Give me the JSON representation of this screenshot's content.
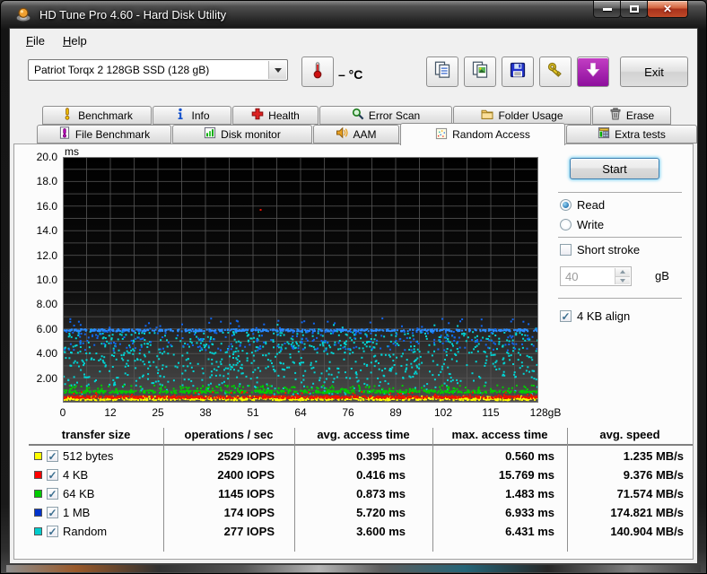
{
  "window": {
    "title": "HD Tune Pro 4.60 - Hard Disk Utility"
  },
  "menu": {
    "file": "File",
    "help": "Help"
  },
  "toolbar": {
    "drive": "Patriot Torqx 2 128GB SSD (128 gB)",
    "temperature": "– °C",
    "buttons": [
      {
        "name": "copy-text-button",
        "icon": "copy-text-icon"
      },
      {
        "name": "copy-image-button",
        "icon": "copy-image-icon"
      },
      {
        "name": "save-button",
        "icon": "save-icon"
      },
      {
        "name": "keys-button",
        "icon": "keys-icon"
      },
      {
        "name": "capture-button",
        "icon": "capture-icon"
      }
    ],
    "exit": "Exit"
  },
  "tabs": {
    "row1": [
      {
        "label": "Benchmark",
        "icon": "benchmark-icon"
      },
      {
        "label": "Info",
        "icon": "info-icon"
      },
      {
        "label": "Health",
        "icon": "health-icon"
      },
      {
        "label": "Error Scan",
        "icon": "error-scan-icon"
      },
      {
        "label": "Folder Usage",
        "icon": "folder-usage-icon"
      },
      {
        "label": "Erase",
        "icon": "erase-icon"
      }
    ],
    "row2": [
      {
        "label": "File Benchmark",
        "icon": "file-benchmark-icon"
      },
      {
        "label": "Disk monitor",
        "icon": "disk-monitor-icon"
      },
      {
        "label": "AAM",
        "icon": "aam-icon"
      },
      {
        "label": "Random Access",
        "icon": "random-access-icon",
        "active": true
      },
      {
        "label": "Extra tests",
        "icon": "extra-tests-icon"
      }
    ]
  },
  "panel": {
    "start": "Start",
    "read": {
      "label": "Read",
      "selected": true
    },
    "write": {
      "label": "Write",
      "selected": false
    },
    "short_stroke": {
      "label": "Short stroke",
      "checked": false,
      "value": "40",
      "unit": "gB"
    },
    "align": {
      "label": "4 KB align",
      "checked": true
    }
  },
  "chart_data": {
    "type": "scatter",
    "title": "Random Access benchmark (access time vs disk position)",
    "x_axis": {
      "unit": "gB",
      "min": 0,
      "max": 128,
      "tick_labels": [
        "0",
        "12",
        "25",
        "38",
        "51",
        "64",
        "76",
        "89",
        "102",
        "115",
        "128gB"
      ]
    },
    "y_axis": {
      "unit": "ms",
      "min": 0,
      "max": 20,
      "tick_labels": [
        "20.0",
        "18.0",
        "16.0",
        "14.0",
        "12.0",
        "10.0",
        "8.00",
        "6.00",
        "4.00",
        "2.00"
      ]
    },
    "plot_bg_top": "#000000",
    "plot_bg_bottom": "#4e4e4e",
    "grid_color": "#565656",
    "grid": true,
    "series": [
      {
        "name": "Random",
        "color": "#00d4d4",
        "bands": [
          {
            "count": 340,
            "y_min": 4.25,
            "y_max": 5.85
          },
          {
            "count": 430,
            "y_min": 1.9,
            "y_max": 4.25
          },
          {
            "count": 120,
            "y_min": 0.75,
            "y_max": 1.9,
            "x_bias": 1.5
          },
          {
            "count": 14,
            "y_min": 5.85,
            "y_max": 6.43
          }
        ]
      },
      {
        "name": "512 bytes",
        "color": "#ffff00",
        "bands": [
          {
            "count": 620,
            "y_min": 0.27,
            "y_max": 0.5
          },
          {
            "count": 50,
            "y_min": 0.5,
            "y_max": 0.6
          }
        ]
      },
      {
        "name": "64 KB",
        "color": "#00cc00",
        "bands": [
          {
            "count": 480,
            "y_min": 0.86,
            "y_max": 1.06
          },
          {
            "count": 150,
            "y_min": 1.06,
            "y_max": 1.48
          }
        ]
      },
      {
        "name": "4 KB",
        "color": "#ee1100",
        "bands": [
          {
            "count": 620,
            "y_min": 0.43,
            "y_max": 0.62
          },
          {
            "count": 40,
            "y_min": 0.62,
            "y_max": 0.95
          }
        ],
        "outliers": [
          {
            "x": 53,
            "y": 15.769
          }
        ]
      },
      {
        "name": "1 MB",
        "color": "#1166ee",
        "bands": [
          {
            "count": 520,
            "y_min": 5.88,
            "y_max": 6.05,
            "color": "#2a8cff"
          },
          {
            "count": 230,
            "y_min": 4.3,
            "y_max": 5.88
          },
          {
            "count": 45,
            "y_min": 6.05,
            "y_max": 6.93
          }
        ]
      }
    ]
  },
  "table": {
    "headers": [
      "transfer size",
      "operations / sec",
      "avg. access time",
      "max. access time",
      "avg. speed"
    ],
    "rows": [
      {
        "swatch": "#ffff00",
        "checked": true,
        "label": "512 bytes",
        "ops": "2529 IOPS",
        "avg": "0.395 ms",
        "max": "0.560 ms",
        "speed": "1.235 MB/s"
      },
      {
        "swatch": "#ff0000",
        "checked": true,
        "label": "4 KB",
        "ops": "2400 IOPS",
        "avg": "0.416 ms",
        "max": "15.769 ms",
        "speed": "9.376 MB/s"
      },
      {
        "swatch": "#00cc00",
        "checked": true,
        "label": "64 KB",
        "ops": "1145 IOPS",
        "avg": "0.873 ms",
        "max": "1.483 ms",
        "speed": "71.574 MB/s"
      },
      {
        "swatch": "#0033cc",
        "checked": true,
        "label": "1 MB",
        "ops": "174 IOPS",
        "avg": "5.720 ms",
        "max": "6.933 ms",
        "speed": "174.821 MB/s"
      },
      {
        "swatch": "#00cccc",
        "checked": true,
        "label": "Random",
        "ops": "277 IOPS",
        "avg": "3.600 ms",
        "max": "6.431 ms",
        "speed": "140.904 MB/s"
      }
    ]
  }
}
